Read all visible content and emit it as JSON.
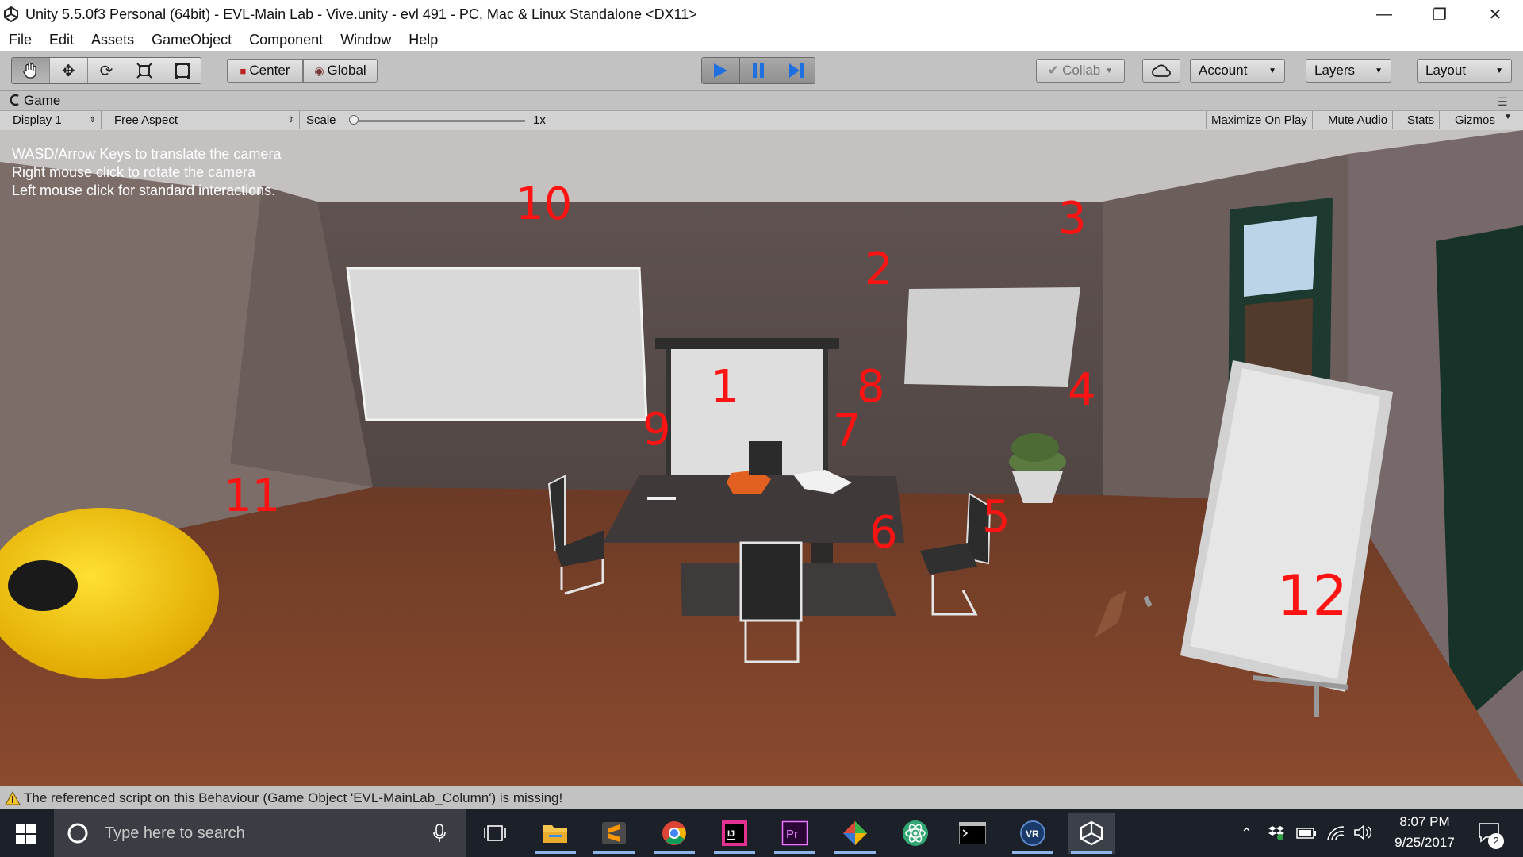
{
  "window": {
    "title": "Unity 5.5.0f3 Personal (64bit) - EVL-Main Lab - Vive.unity - evl 491 - PC, Mac & Linux Standalone <DX11>",
    "controls": [
      "minimize-icon",
      "restore-icon",
      "close-icon"
    ]
  },
  "menu": [
    "File",
    "Edit",
    "Assets",
    "GameObject",
    "Component",
    "Window",
    "Help"
  ],
  "toolbar": {
    "tools": [
      "hand-icon",
      "move-icon",
      "rotate-icon",
      "scale-icon",
      "rect-icon"
    ],
    "pivot_mode": "Center",
    "pivot_rotation": "Global",
    "play_icons": [
      "play-icon",
      "pause-icon",
      "step-icon"
    ],
    "collab": "Collab",
    "account": "Account",
    "layers": "Layers",
    "layout": "Layout"
  },
  "game_view": {
    "tab_label": "Game",
    "display": "Display 1",
    "aspect": "Free Aspect",
    "scale_label": "Scale",
    "scale_value": "1x",
    "scale_fraction": 0.0,
    "buttons": [
      "Maximize On Play",
      "Mute Audio",
      "Stats",
      "Gizmos"
    ],
    "hints": [
      "WASD/Arrow Keys to translate the camera",
      "Right mouse click to rotate the camera",
      "Left mouse click for standard interactions."
    ],
    "annotations": [
      "10",
      "3",
      "2",
      "1",
      "8",
      "9",
      "7",
      "4",
      "11",
      "6",
      "5",
      "12"
    ]
  },
  "status": {
    "message": "The referenced script on this Behaviour (Game Object 'EVL-MainLab_Column') is missing!"
  },
  "taskbar": {
    "search_placeholder": "Type here to search",
    "apps": [
      "task-view-icon",
      "file-explorer-icon",
      "sublime-text-icon",
      "chrome-icon",
      "intellij-icon",
      "premiere-icon",
      "git-kraken-icon",
      "atom-icon",
      "terminal-icon",
      "vr-icon",
      "unity-icon"
    ],
    "time": "8:07 PM",
    "date": "9/25/2017",
    "notification_count": "2"
  },
  "colors": {
    "annotation_red": "#ff1212",
    "play_blue": "#1e6fe0",
    "floor": "#7a3e25",
    "wall": "#6e615e"
  }
}
